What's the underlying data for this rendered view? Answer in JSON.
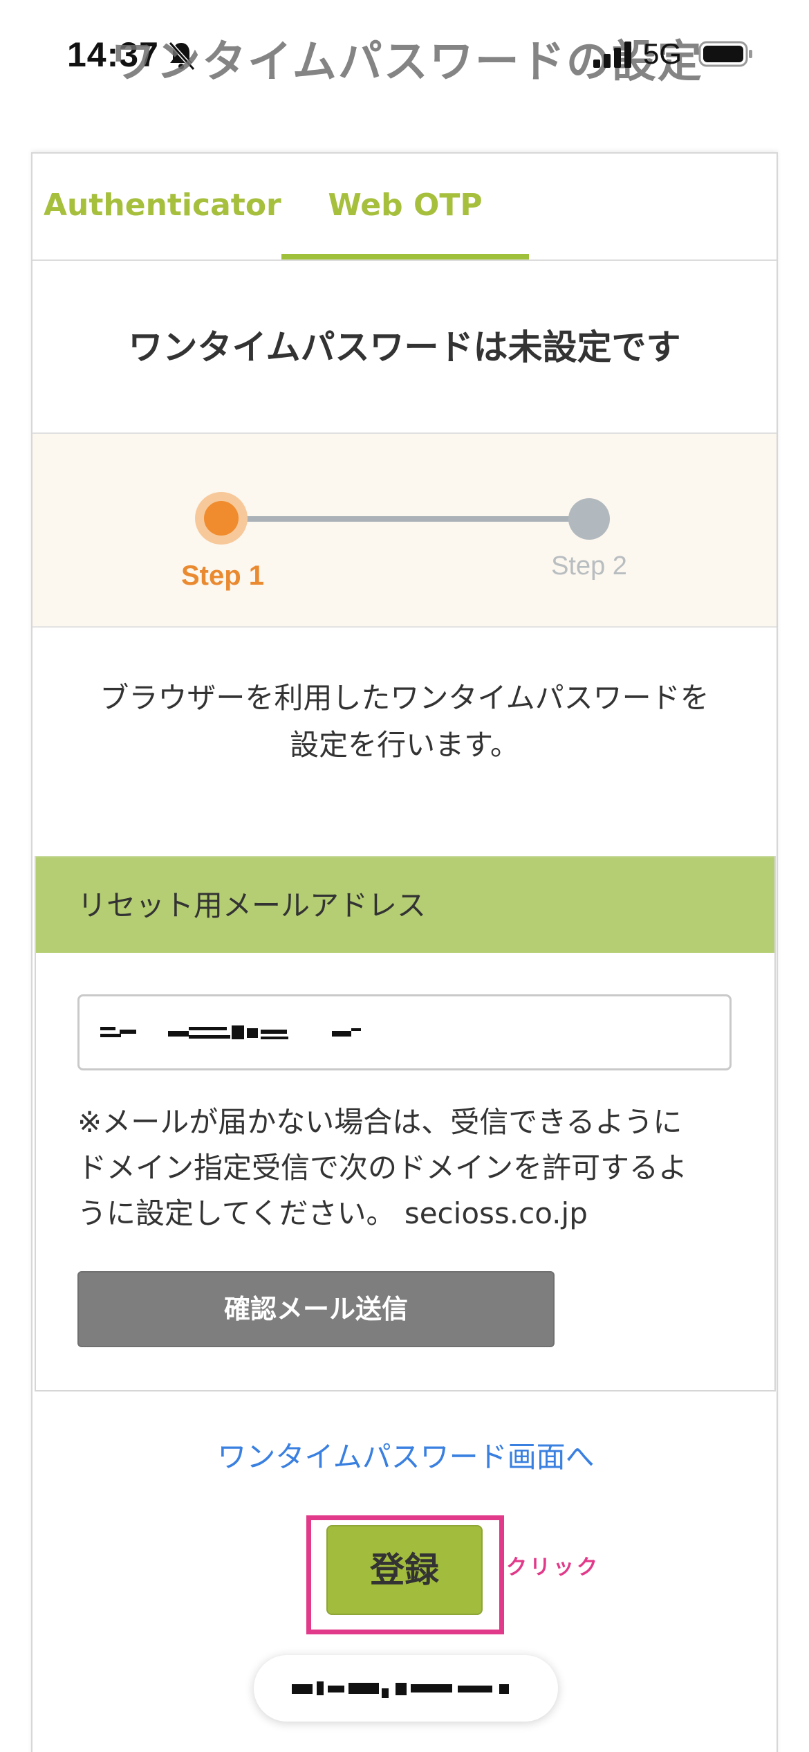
{
  "status_bar": {
    "time": "14:37",
    "network": "5G",
    "icons": [
      "bell-slash-icon",
      "signal-icon",
      "battery-icon"
    ]
  },
  "page_heading": "ワンタイムパスワードの設定",
  "tabs": [
    {
      "label": "Authenticator",
      "selected": false
    },
    {
      "label": "Web OTP",
      "selected": true
    }
  ],
  "status_title": "ワンタイムパスワードは未設定です",
  "stepper": {
    "steps": [
      {
        "label": "Step 1",
        "active": true
      },
      {
        "label": "Step 2",
        "active": false
      }
    ]
  },
  "description": {
    "line1": "ブラウザーを利用したワンタイムパスワードを",
    "line2": "設定を行います。"
  },
  "reset": {
    "header": "リセット用メールアドレス",
    "email_value_redacted": true,
    "note_line1": "※メールが届かない場合は、受信できるように",
    "note_line2": "ドメイン指定受信で次のドメインを許可するよ",
    "note_line3": "うに設定してください。 secioss.co.jp",
    "send_button": "確認メール送信"
  },
  "otp_link": "ワンタイムパスワード画面へ",
  "register_button": "登録",
  "annotation": "クリック",
  "colors": {
    "accent_green": "#a2bd3e",
    "tab_text": "#a6bf3c",
    "step_active": "#f08c2e",
    "step_inactive": "#b1b9be",
    "link_blue": "#3a80e0",
    "highlight_pink": "#e23a8a",
    "section_header": "#b5ce73"
  }
}
